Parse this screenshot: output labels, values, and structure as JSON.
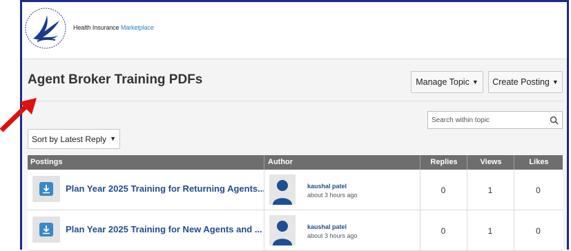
{
  "header": {
    "site_name_part1": "Health Insurance ",
    "site_name_part2": "Marketplace",
    "logo_icon": "hhs-eagle-seal"
  },
  "topic": {
    "title": "Agent Broker Training PDFs",
    "manage_label": "Manage Topic",
    "create_label": "Create Posting"
  },
  "search": {
    "placeholder": "Search within topic",
    "icon": "search-icon"
  },
  "sort": {
    "label": "Sort by Latest Reply"
  },
  "table": {
    "headers": {
      "postings": "Postings",
      "author": "Author",
      "replies": "Replies",
      "views": "Views",
      "likes": "Likes"
    },
    "rows": [
      {
        "title": "Plan Year 2025 Training for Returning Agents...",
        "author": "kaushal patel",
        "time": "about 3 hours ago",
        "replies": "0",
        "views": "1",
        "likes": "0"
      },
      {
        "title": "Plan Year 2025 Training for New Agents and ...",
        "author": "kaushal patel",
        "time": "about 3 hours ago",
        "replies": "0",
        "views": "1",
        "likes": "0"
      }
    ]
  },
  "colors": {
    "frame": "#1a2a8c",
    "link": "#1f4e8c",
    "header_bg": "#6e6e6e",
    "arrow": "#e01010"
  }
}
